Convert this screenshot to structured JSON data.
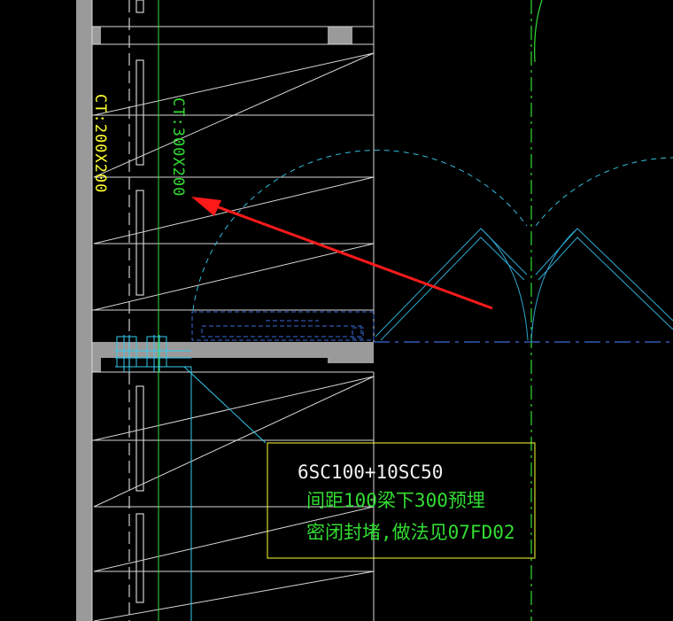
{
  "labels": {
    "left_tray": "CT:200X200",
    "green_tray": "CT:300X200"
  },
  "note": {
    "line1": "6SC100+10SC50",
    "line2": "间距100梁下300预埋",
    "line3": "密闭封堵,做法见07FD02"
  },
  "colors": {
    "wall": "#9a9a9a",
    "frame": "#e6e6e6",
    "yellow": "#ffff33",
    "green": "#33dd33",
    "cyan": "#33ccee",
    "blue": "#3a6bd8",
    "arrow": "#ff1a1a",
    "background": "#000000"
  }
}
